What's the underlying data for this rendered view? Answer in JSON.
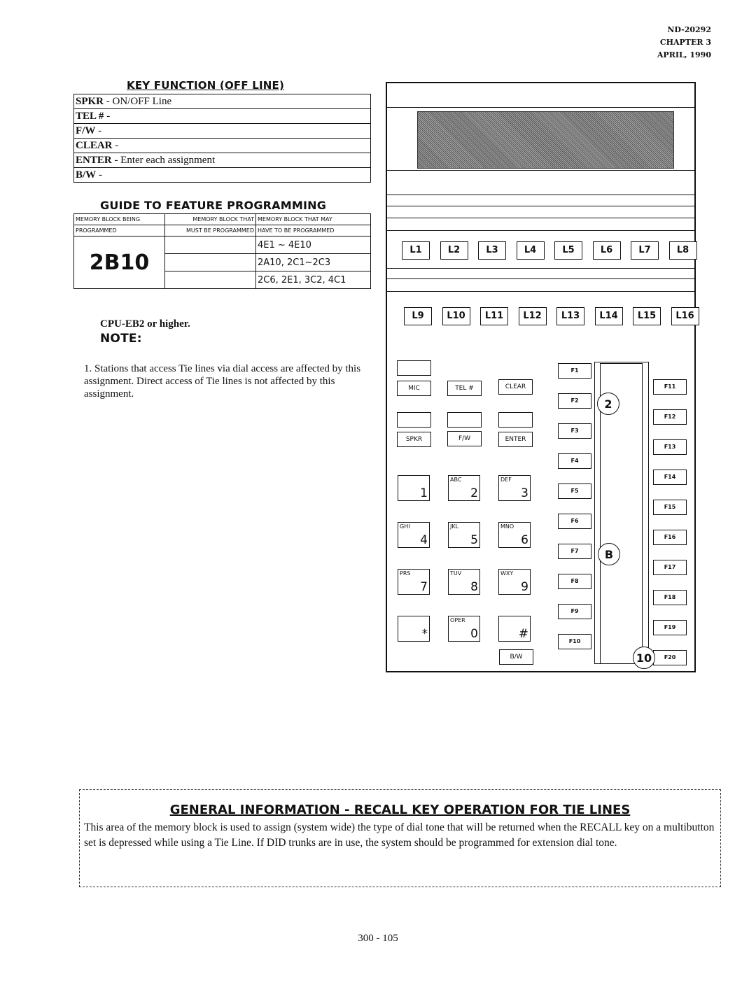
{
  "header": {
    "doc_number": "ND-20292",
    "chapter": "CHAPTER 3",
    "date": "APRIL, 1990"
  },
  "key_function": {
    "title": "KEY FUNCTION (OFF LINE)",
    "rows": [
      {
        "key": "SPKR",
        "desc": " - ON/OFF Line"
      },
      {
        "key": "TEL #",
        "desc": " -"
      },
      {
        "key": "F/W",
        "desc": "  -"
      },
      {
        "key": "CLEAR",
        "desc": " -"
      },
      {
        "key": "ENTER",
        "desc": " - Enter each assignment"
      },
      {
        "key": "B/W",
        "desc": " -"
      }
    ]
  },
  "guide": {
    "title": "GUIDE TO FEATURE PROGRAMMING",
    "headers": [
      [
        "MEMORY BLOCK BEING",
        "PROGRAMMED"
      ],
      [
        "MEMORY BLOCK THAT",
        "MUST BE PROGRAMMED"
      ],
      [
        "MEMORY BLOCK THAT MAY",
        "HAVE TO BE PROGRAMMED"
      ]
    ],
    "block": "2B10",
    "may_program": [
      "4E1 ~ 4E10",
      "2A10, 2C1~2C3",
      "2C6, 2E1, 3C2, 4C1"
    ]
  },
  "requirement": "CPU-EB2 or higher.",
  "note": {
    "title": "NOTE:",
    "items": [
      "1.  Stations that access Tie lines via dial access are affected by this assignment.  Direct access of Tie lines is not affected by this assignment."
    ]
  },
  "phone": {
    "line_keys": [
      "L1",
      "L2",
      "L3",
      "L4",
      "L5",
      "L6",
      "L7",
      "L8",
      "L9",
      "L10",
      "L11",
      "L12",
      "L13",
      "L14",
      "L15",
      "L16"
    ],
    "feature_keys": [
      "F1",
      "F2",
      "F3",
      "F4",
      "F5",
      "F6",
      "F7",
      "F8",
      "F9",
      "F10",
      "F11",
      "F12",
      "F13",
      "F14",
      "F15",
      "F16",
      "F17",
      "F18",
      "F19",
      "F20"
    ],
    "soft_keys": [
      "MIC",
      "TEL #",
      "CLEAR",
      "SPKR",
      "F/W",
      "ENTER",
      "B/W"
    ],
    "dial_keys": [
      {
        "letters": "",
        "num": "1"
      },
      {
        "letters": "ABC",
        "num": "2"
      },
      {
        "letters": "DEF",
        "num": "3"
      },
      {
        "letters": "GHI",
        "num": "4"
      },
      {
        "letters": "JKL",
        "num": "5"
      },
      {
        "letters": "MNO",
        "num": "6"
      },
      {
        "letters": "PRS",
        "num": "7"
      },
      {
        "letters": "TUV",
        "num": "8"
      },
      {
        "letters": "WXY",
        "num": "9"
      },
      {
        "letters": "",
        "num": "*"
      },
      {
        "letters": "OPER",
        "num": "0"
      },
      {
        "letters": "",
        "num": "#"
      }
    ],
    "callouts": [
      "2",
      "B",
      "10"
    ]
  },
  "general_info": {
    "title": "GENERAL INFORMATION - RECALL KEY OPERATION FOR TIE LINES",
    "body": "This area of the memory block is used to assign (system wide) the type of dial tone that will be returned when the RECALL key on a multibutton set is depressed while using a Tie Line.   If DID trunks are in use, the system should be programmed for extension dial tone."
  },
  "page_number": "300 - 105"
}
